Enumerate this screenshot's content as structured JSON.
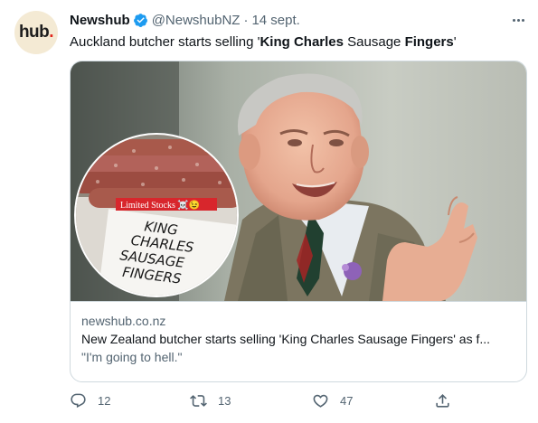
{
  "author": {
    "display_name": "Newshub",
    "handle": "@NewshubNZ",
    "separator": "·",
    "date": "14 sept.",
    "avatar_text": "hub",
    "avatar_dot": ".",
    "verified": true
  },
  "tweet": {
    "text_parts": [
      "Auckland butcher starts selling '",
      "King Charles",
      " Sausage ",
      "Fingers",
      "'"
    ]
  },
  "card": {
    "image_labels": {
      "sticker": "Limited Stocks ☠️😉",
      "sign_line1": "KING",
      "sign_line2": "CHARLES",
      "sign_line3": "SAUSAGE",
      "sign_line4": "FINGERS"
    },
    "domain": "newshub.co.nz",
    "title": "New Zealand butcher starts selling 'King Charles Sausage Fingers' as f...",
    "description": "\"I'm going to hell.\""
  },
  "actions": {
    "reply_count": "12",
    "retweet_count": "13",
    "like_count": "47"
  },
  "icons": [
    "verified-icon",
    "more-icon",
    "reply-icon",
    "retweet-icon",
    "like-icon",
    "share-icon"
  ],
  "colors": {
    "text_primary": "#0f1419",
    "text_secondary": "#536471",
    "verified": "#1d9bf0",
    "border": "#cfd9de",
    "sticker_red": "#d8262c"
  }
}
